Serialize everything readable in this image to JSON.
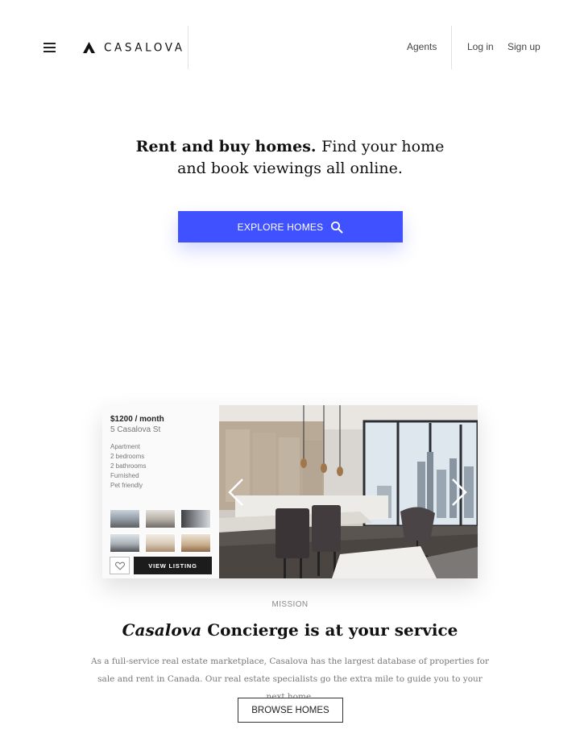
{
  "header": {
    "brand": "CASALOVA",
    "nav": {
      "agents": "Agents",
      "login": "Log in",
      "signup": "Sign up"
    }
  },
  "hero": {
    "title_bold": "Rent and buy homes.",
    "title_rest": "Find your home and book viewings all online.",
    "cta_label": "EXPLORE HOMES"
  },
  "listing": {
    "price": "$1200 / month",
    "address": "5 Casalova St",
    "features": [
      "Apartment",
      "2 bedrooms",
      "2 bathrooms",
      "Furnished",
      "Pet friendly"
    ],
    "view_label": "VIEW LISTING"
  },
  "mission": {
    "eyebrow": "MISSION",
    "title_brand": "Casalova",
    "title_rest": "Concierge is at your service",
    "body": "As a full-service real estate marketplace, Casalova has the largest database of properties for sale and rent in Canada. Our real estate specialists go the extra mile to guide you to your next home.",
    "cta_label": "BROWSE HOMES"
  },
  "colors": {
    "accent": "#4051ff",
    "text": "#111111",
    "muted": "#777777",
    "dark_button": "#1c1c1c"
  },
  "icons": [
    "hamburger-menu-icon",
    "casalova-logo-icon",
    "search-icon",
    "heart-icon",
    "chevron-left-icon",
    "chevron-right-icon"
  ]
}
